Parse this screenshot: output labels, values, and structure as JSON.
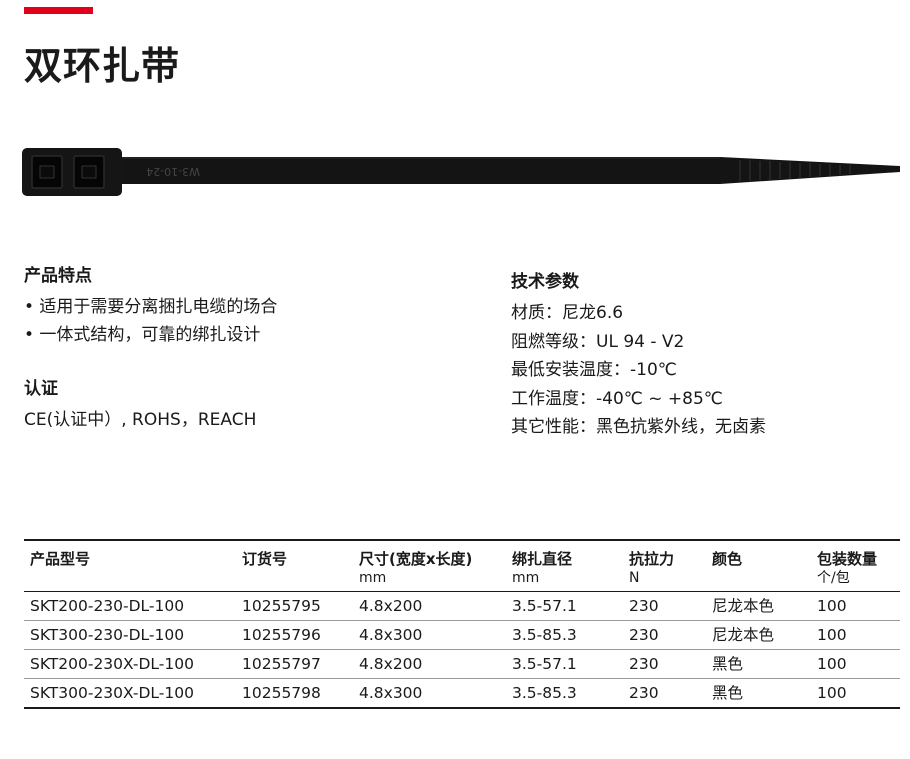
{
  "title": "双环扎带",
  "colors": {
    "accent": "#e2001a",
    "tie": "#111111"
  },
  "product_image": {
    "icon": "cable-tie-icon",
    "imprint": "W3-10-24"
  },
  "features": {
    "heading": "产品特点",
    "items": [
      "• 适用于需要分离捆扎电缆的场合",
      "• 一体式结构，可靠的绑扎设计"
    ]
  },
  "certification": {
    "heading": "认证",
    "text": "CE(认证中）, ROHS，REACH"
  },
  "specs": {
    "heading": "技术参数",
    "items": [
      "材质：尼龙6.6",
      "阻燃等级：UL 94 - V2",
      "最低安装温度：-10℃",
      "工作温度：-40℃ ~ +85℃",
      "其它性能：黑色抗紫外线，无卤素"
    ]
  },
  "table": {
    "columns": [
      {
        "label": "产品型号",
        "unit": ""
      },
      {
        "label": "订货号",
        "unit": ""
      },
      {
        "label": "尺寸(宽度x长度)",
        "unit": "mm"
      },
      {
        "label": "绑扎直径",
        "unit": "mm"
      },
      {
        "label": "抗拉力",
        "unit": "N"
      },
      {
        "label": "颜色",
        "unit": ""
      },
      {
        "label": "包装数量",
        "unit": "个/包"
      }
    ],
    "rows": [
      [
        "SKT200-230-DL-100",
        "10255795",
        "4.8x200",
        "3.5-57.1",
        "230",
        "尼龙本色",
        "100"
      ],
      [
        "SKT300-230-DL-100",
        "10255796",
        "4.8x300",
        "3.5-85.3",
        "230",
        "尼龙本色",
        "100"
      ],
      [
        "SKT200-230X-DL-100",
        "10255797",
        "4.8x200",
        "3.5-57.1",
        "230",
        "黑色",
        "100"
      ],
      [
        "SKT300-230X-DL-100",
        "10255798",
        "4.8x300",
        "3.5-85.3",
        "230",
        "黑色",
        "100"
      ]
    ]
  }
}
